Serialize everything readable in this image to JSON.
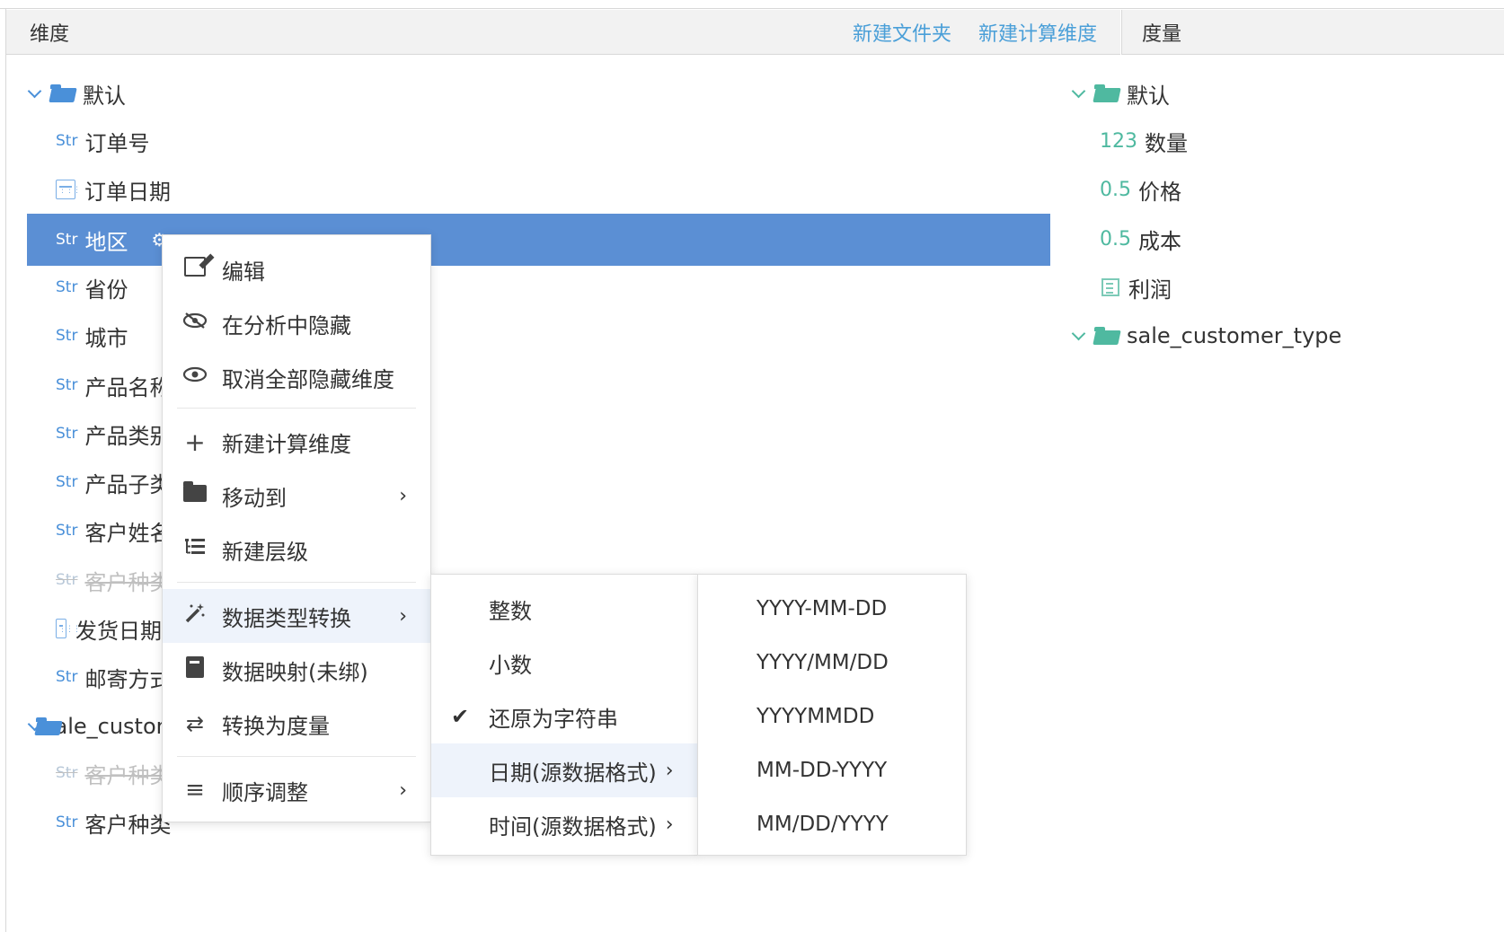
{
  "dimension_panel": {
    "title": "维度",
    "actions": [
      "新建文件夹",
      "新建计算维度"
    ],
    "groups": [
      {
        "name": "默认",
        "fields": [
          {
            "type": "Str",
            "label": "订单号"
          },
          {
            "type": "date",
            "label": "订单日期"
          },
          {
            "type": "Str",
            "label": "地区",
            "selected": true
          },
          {
            "type": "Str",
            "label": "省份"
          },
          {
            "type": "Str",
            "label": "城市"
          },
          {
            "type": "Str",
            "label": "产品名称"
          },
          {
            "type": "Str",
            "label": "产品类别"
          },
          {
            "type": "Str",
            "label": "产品子类"
          },
          {
            "type": "Str",
            "label": "客户姓名"
          },
          {
            "type": "Str",
            "label": "客户种类",
            "hidden": true
          },
          {
            "type": "date",
            "label": "发货日期"
          },
          {
            "type": "Str",
            "label": "邮寄方式"
          }
        ]
      },
      {
        "name": "sale_customer_type",
        "fields": [
          {
            "type": "Str",
            "label": "客户种类",
            "hidden": true
          },
          {
            "type": "Str",
            "label": "客户种类"
          }
        ]
      }
    ]
  },
  "measure_panel": {
    "title": "度量",
    "groups": [
      {
        "name": "默认",
        "fields": [
          {
            "type": "123",
            "label": "数量"
          },
          {
            "type": "0.5",
            "label": "价格"
          },
          {
            "type": "0.5",
            "label": "成本"
          },
          {
            "type": "calc",
            "label": "利润"
          }
        ]
      },
      {
        "name": "sale_customer_type",
        "fields": []
      }
    ]
  },
  "context_menu": {
    "items": [
      {
        "icon": "edit-icon",
        "label": "编辑"
      },
      {
        "icon": "eye-slash-icon",
        "label": "在分析中隐藏"
      },
      {
        "icon": "eye-icon",
        "label": "取消全部隐藏维度"
      },
      {
        "icon": "plus-icon",
        "label": "新建计算维度"
      },
      {
        "icon": "folder-icon",
        "label": "移动到",
        "submenu": true
      },
      {
        "icon": "hierarchy-icon",
        "label": "新建层级"
      },
      {
        "icon": "magic-wand-icon",
        "label": "数据类型转换",
        "submenu": true,
        "active": true
      },
      {
        "icon": "book-icon",
        "label": "数据映射(未绑)"
      },
      {
        "icon": "swap-icon",
        "label": "转换为度量"
      },
      {
        "icon": "list-icon",
        "label": "顺序调整",
        "submenu": true
      }
    ]
  },
  "type_submenu": {
    "items": [
      {
        "label": "整数"
      },
      {
        "label": "小数"
      },
      {
        "label": "还原为字符串",
        "checked": true
      },
      {
        "label": "日期(源数据格式)",
        "submenu": true,
        "active": true
      },
      {
        "label": "时间(源数据格式)",
        "submenu": true
      }
    ]
  },
  "date_format_submenu": {
    "items": [
      "YYYY-MM-DD",
      "YYYY/MM/DD",
      "YYYYMMDD",
      "MM-DD-YYYY",
      "MM/DD/YYYY"
    ]
  },
  "colors": {
    "accent": "#4a9fd8",
    "selected_row": "#5b8fd4",
    "measure": "#4fb9a0"
  }
}
